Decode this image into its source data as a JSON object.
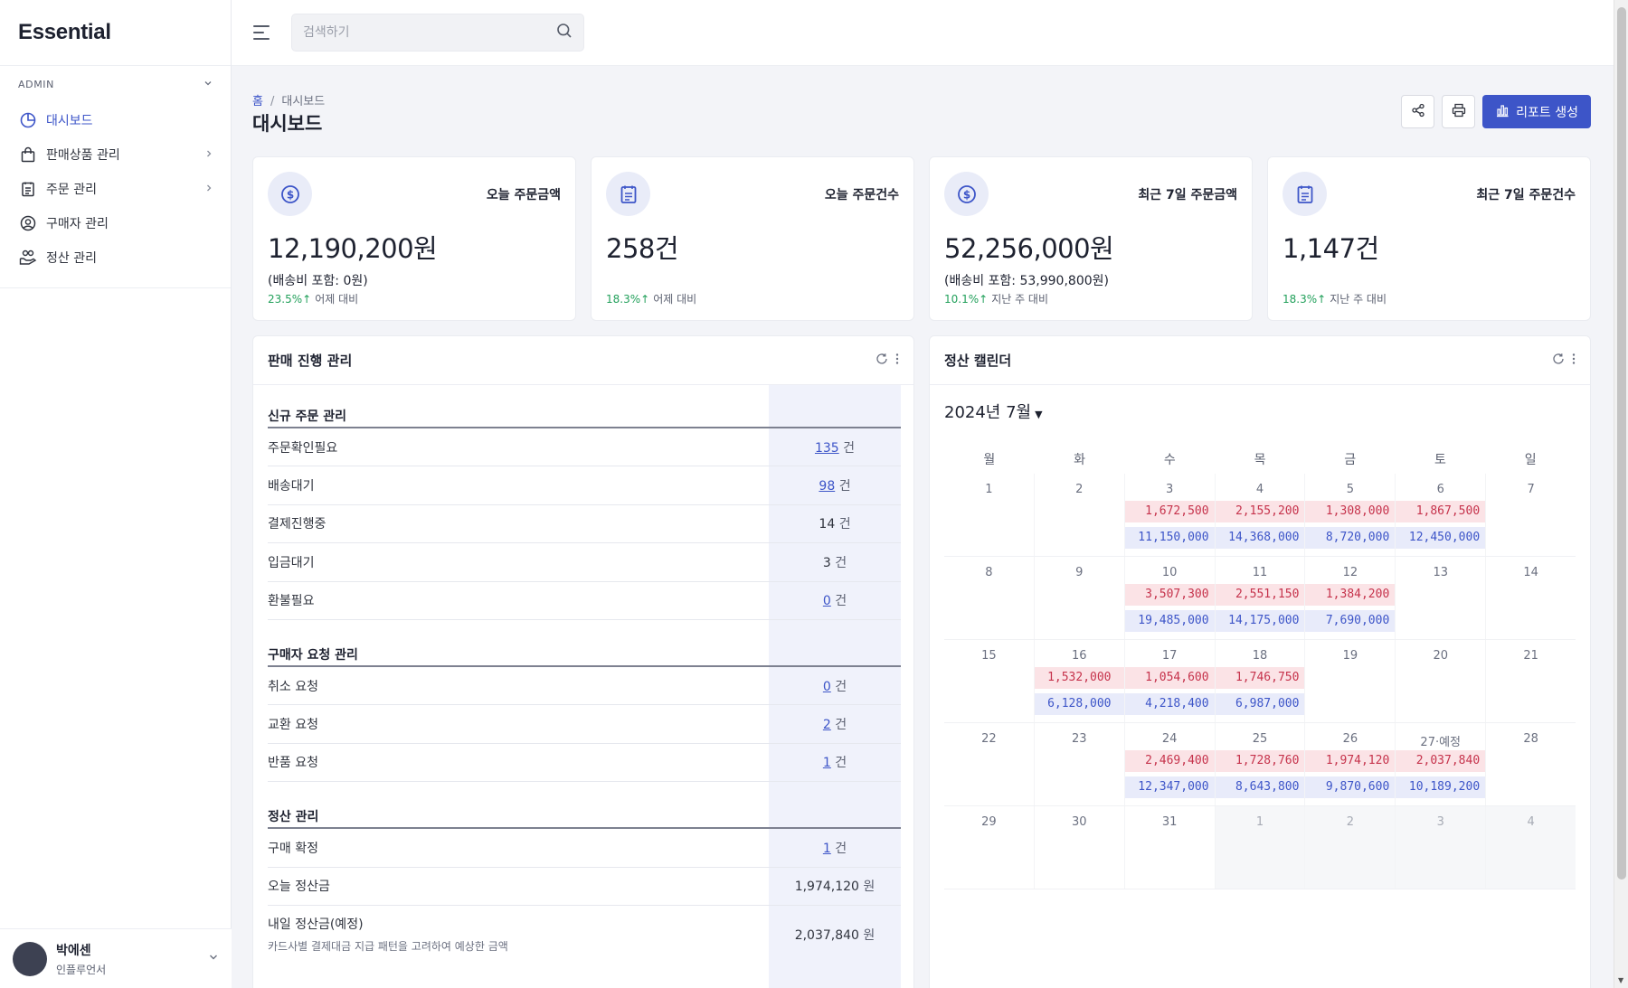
{
  "app": {
    "brand": "Essential"
  },
  "sidebar": {
    "section": "ADMIN",
    "items": [
      {
        "label": "대시보드",
        "icon": "pie-chart-icon",
        "active": true
      },
      {
        "label": "판매상품 관리",
        "icon": "shopping-bag-icon"
      },
      {
        "label": "주문 관리",
        "icon": "clipboard-icon"
      },
      {
        "label": "구매자 관리",
        "icon": "user-circle-icon"
      },
      {
        "label": "정산 관리",
        "icon": "coins-hand-icon"
      }
    ],
    "user": {
      "name": "박에센",
      "role": "인플루언서"
    }
  },
  "search": {
    "placeholder": "검색하기"
  },
  "breadcrumb": {
    "home": "홈",
    "current": "대시보드"
  },
  "page": {
    "title": "대시보드",
    "report_button": "리포트 생성"
  },
  "stats": [
    {
      "label": "오늘 주문금액",
      "value": "12,190,200원",
      "sub": "(배송비 포함: 0원)",
      "trend": "23.5%",
      "trend_arrow": "↑",
      "trend_label": "어제 대비",
      "icon": "dollar-icon"
    },
    {
      "label": "오늘 주문건수",
      "value": "258건",
      "sub": "",
      "trend": "18.3%",
      "trend_arrow": "↑",
      "trend_label": "어제 대비",
      "icon": "clipboard-icon"
    },
    {
      "label": "최근 7일 주문금액",
      "value": "52,256,000원",
      "sub": "(배송비 포함: 53,990,800원)",
      "trend": "10.1%",
      "trend_arrow": "↑",
      "trend_label": "지난 주 대비",
      "icon": "dollar-icon"
    },
    {
      "label": "최근 7일 주문건수",
      "value": "1,147건",
      "sub": "",
      "trend": "18.3%",
      "trend_arrow": "↑",
      "trend_label": "지난 주 대비",
      "icon": "clipboard-icon"
    }
  ],
  "sales_panel": {
    "title": "판매 진행 관리",
    "sections": [
      {
        "title": "신규 주문 관리",
        "rows": [
          {
            "name": "주문확인필요",
            "count": "135",
            "unit": "건",
            "link": true
          },
          {
            "name": "배송대기",
            "count": "98",
            "unit": "건",
            "link": true
          },
          {
            "name": "결제진행중",
            "count": "14",
            "unit": "건",
            "link": false
          },
          {
            "name": "입금대기",
            "count": "3",
            "unit": "건",
            "link": false
          },
          {
            "name": "환불필요",
            "count": "0",
            "unit": "건",
            "link": true
          }
        ]
      },
      {
        "title": "구매자 요청 관리",
        "rows": [
          {
            "name": "취소 요청",
            "count": "0",
            "unit": "건",
            "link": true
          },
          {
            "name": "교환 요청",
            "count": "2",
            "unit": "건",
            "link": true
          },
          {
            "name": "반품 요청",
            "count": "1",
            "unit": "건",
            "link": true
          }
        ]
      },
      {
        "title": "정산 관리",
        "rows": [
          {
            "name": "구매 확정",
            "count": "1",
            "unit": "건",
            "link": true
          },
          {
            "name": "오늘 정산금",
            "count": "1,974,120",
            "unit": "원",
            "link": false
          },
          {
            "name": "내일 정산금(예정)",
            "note": "카드사별 결제대금 지급 패턴을 고려하여 예상한 금액",
            "count": "2,037,840",
            "unit": "원",
            "link": false
          }
        ]
      }
    ]
  },
  "calendar_panel": {
    "title": "정산 캘린더",
    "month": "2024년 7월",
    "weekdays": [
      "월",
      "화",
      "수",
      "목",
      "금",
      "토",
      "일"
    ],
    "weeks": [
      [
        {
          "day": "1"
        },
        {
          "day": "2"
        },
        {
          "day": "3",
          "red": "1,672,500",
          "blue": "11,150,000"
        },
        {
          "day": "4",
          "red": "2,155,200",
          "blue": "14,368,000"
        },
        {
          "day": "5",
          "red": "1,308,000",
          "blue": "8,720,000"
        },
        {
          "day": "6",
          "red": "1,867,500",
          "blue": "12,450,000"
        },
        {
          "day": "7"
        }
      ],
      [
        {
          "day": "8"
        },
        {
          "day": "9"
        },
        {
          "day": "10",
          "red": "3,507,300",
          "blue": "19,485,000"
        },
        {
          "day": "11",
          "red": "2,551,150",
          "blue": "14,175,000"
        },
        {
          "day": "12",
          "red": "1,384,200",
          "blue": "7,690,000"
        },
        {
          "day": "13"
        },
        {
          "day": "14"
        }
      ],
      [
        {
          "day": "15"
        },
        {
          "day": "16",
          "red": "1,532,000",
          "blue": "6,128,000"
        },
        {
          "day": "17",
          "red": "1,054,600",
          "blue": "4,218,400"
        },
        {
          "day": "18",
          "red": "1,746,750",
          "blue": "6,987,000"
        },
        {
          "day": "19"
        },
        {
          "day": "20"
        },
        {
          "day": "21"
        }
      ],
      [
        {
          "day": "22"
        },
        {
          "day": "23"
        },
        {
          "day": "24",
          "red": "2,469,400",
          "blue": "12,347,000"
        },
        {
          "day": "25",
          "red": "1,728,760",
          "blue": "8,643,800"
        },
        {
          "day": "26",
          "red": "1,974,120",
          "blue": "9,870,600"
        },
        {
          "day": "27·예정",
          "red": "2,037,840",
          "blue": "10,189,200"
        },
        {
          "day": "28"
        }
      ],
      [
        {
          "day": "29"
        },
        {
          "day": "30"
        },
        {
          "day": "31"
        },
        {
          "day": "1",
          "dim": true
        },
        {
          "day": "2",
          "dim": true
        },
        {
          "day": "3",
          "dim": true
        },
        {
          "day": "4",
          "dim": true
        }
      ]
    ]
  },
  "colors": {
    "accent": "#3d55c8",
    "positive": "#22a05b",
    "settle_red": "#c6334c",
    "settle_blue": "#3d55c8"
  }
}
